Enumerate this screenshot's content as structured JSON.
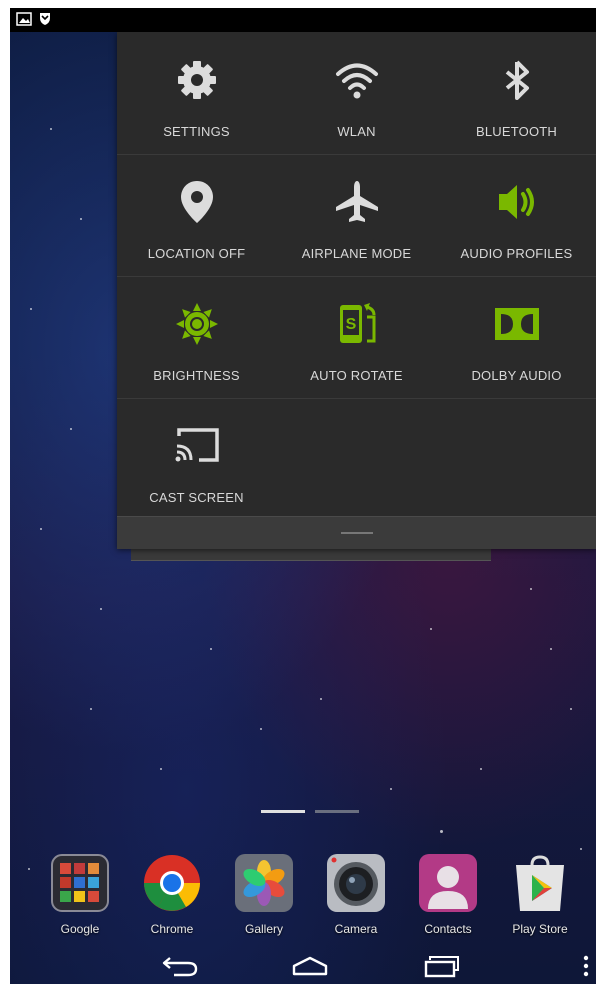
{
  "quick_settings": {
    "tiles": [
      {
        "label": "SETTINGS",
        "icon": "gear-icon",
        "color": "#dcdcdc"
      },
      {
        "label": "WLAN",
        "icon": "wifi-icon",
        "color": "#dcdcdc"
      },
      {
        "label": "BLUETOOTH",
        "icon": "bluetooth-icon",
        "color": "#dcdcdc"
      },
      {
        "label": "LOCATION OFF",
        "icon": "location-pin-icon",
        "color": "#dcdcdc"
      },
      {
        "label": "AIRPLANE MODE",
        "icon": "airplane-icon",
        "color": "#dcdcdc"
      },
      {
        "label": "AUDIO PROFILES",
        "icon": "speaker-icon",
        "color": "#7ab800"
      },
      {
        "label": "BRIGHTNESS",
        "icon": "sun-icon",
        "color": "#7ab800"
      },
      {
        "label": "AUTO ROTATE",
        "icon": "rotate-phone-icon",
        "color": "#7ab800"
      },
      {
        "label": "DOLBY AUDIO",
        "icon": "dolby-icon",
        "color": "#7ab800"
      },
      {
        "label": "CAST SCREEN",
        "icon": "cast-icon",
        "color": "#dcdcdc"
      }
    ]
  },
  "dock": {
    "apps": [
      {
        "label": "Google",
        "icon": "google-folder-icon"
      },
      {
        "label": "Chrome",
        "icon": "chrome-icon"
      },
      {
        "label": "Gallery",
        "icon": "gallery-icon"
      },
      {
        "label": "Camera",
        "icon": "camera-icon"
      },
      {
        "label": "Contacts",
        "icon": "contacts-icon"
      },
      {
        "label": "Play Store",
        "icon": "play-store-icon"
      }
    ]
  },
  "navigation": {
    "buttons": [
      "back-icon",
      "home-icon",
      "recent-apps-icon",
      "overflow-menu-icon"
    ]
  },
  "status_bar": {
    "icons": [
      "screenshot-icon",
      "notification-shield-icon"
    ]
  },
  "home": {
    "pages": 2,
    "current_page": 1
  },
  "colors": {
    "accent_green": "#7ab800",
    "panel_bg": "#2a2a2a"
  }
}
